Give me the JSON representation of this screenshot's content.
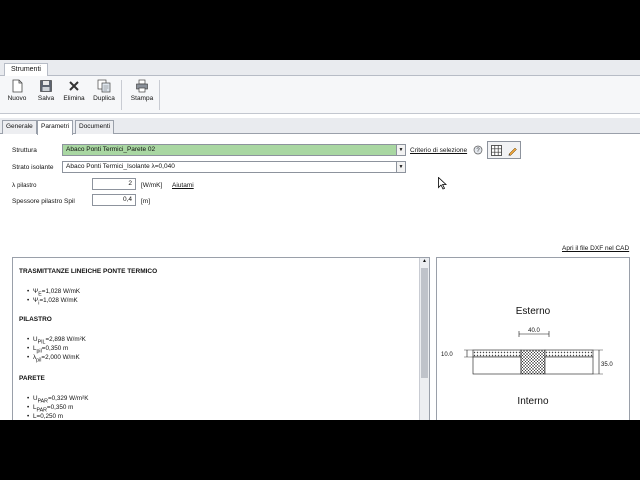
{
  "ribbon": {
    "tab": "Strumenti",
    "buttons": [
      {
        "label": "Nuovo",
        "icon": "new-document-icon"
      },
      {
        "label": "Salva",
        "icon": "save-disk-icon"
      },
      {
        "label": "Elimina",
        "icon": "delete-x-icon"
      },
      {
        "label": "Duplica",
        "icon": "duplicate-icon"
      },
      {
        "label": "Stampa",
        "icon": "printer-icon"
      }
    ]
  },
  "subtabs": [
    "Generale",
    "Parametri",
    "Documenti"
  ],
  "form": {
    "struttura_label": "Struttura",
    "struttura_value": "Abaco Ponti Termici_Parete 02",
    "criterio_link": "Criterio di selezione",
    "strato_label": "Strato isolante",
    "strato_value": "Abaco Ponti Termici_Isolante λ=0,040",
    "lambda_label_sym": "λ",
    "lambda_label_sub": "pilastro",
    "lambda_value": "2",
    "lambda_unit": "[W/mK]",
    "aiutami_link": "Aiutami",
    "spessore_label": "Spessore pilastro Spil",
    "spessore_value": "0,4",
    "spessore_unit": "[m]",
    "apri_dxf_link": "Apri il file DXF nel CAD"
  },
  "report": {
    "title": "TRASMITTANZE LINEICHE PONTE TERMICO",
    "psi": [
      {
        "sym": "Ψ",
        "sub": "E",
        "text": "=1,028 W/mK"
      },
      {
        "sym": "Ψ",
        "sub": "i",
        "text": "=1,028 W/mK"
      }
    ],
    "pilastro_title": "PILASTRO",
    "pilastro": [
      {
        "sym": "U",
        "sub": "PIL",
        "text": "=2,898 W/m²K"
      },
      {
        "sym": "L",
        "sub": "pil",
        "text": "=0,350 m"
      },
      {
        "sym": "λ",
        "sub": "pil",
        "text": "=2,000 W/mK"
      }
    ],
    "parete_title": "PARETE",
    "parete": [
      {
        "sym": "U",
        "sub": "PAR",
        "text": "=0,329 W/m²K"
      },
      {
        "sym": "L",
        "sub": "PAR",
        "text": "=0,350 m"
      },
      {
        "sym": "L",
        "sub": "",
        "text": "=0,250 m"
      }
    ]
  },
  "diagram": {
    "esterno": "Esterno",
    "interno": "Interno",
    "dim_top": "40.0",
    "dim_left": "10.0",
    "dim_right": "35.0"
  }
}
